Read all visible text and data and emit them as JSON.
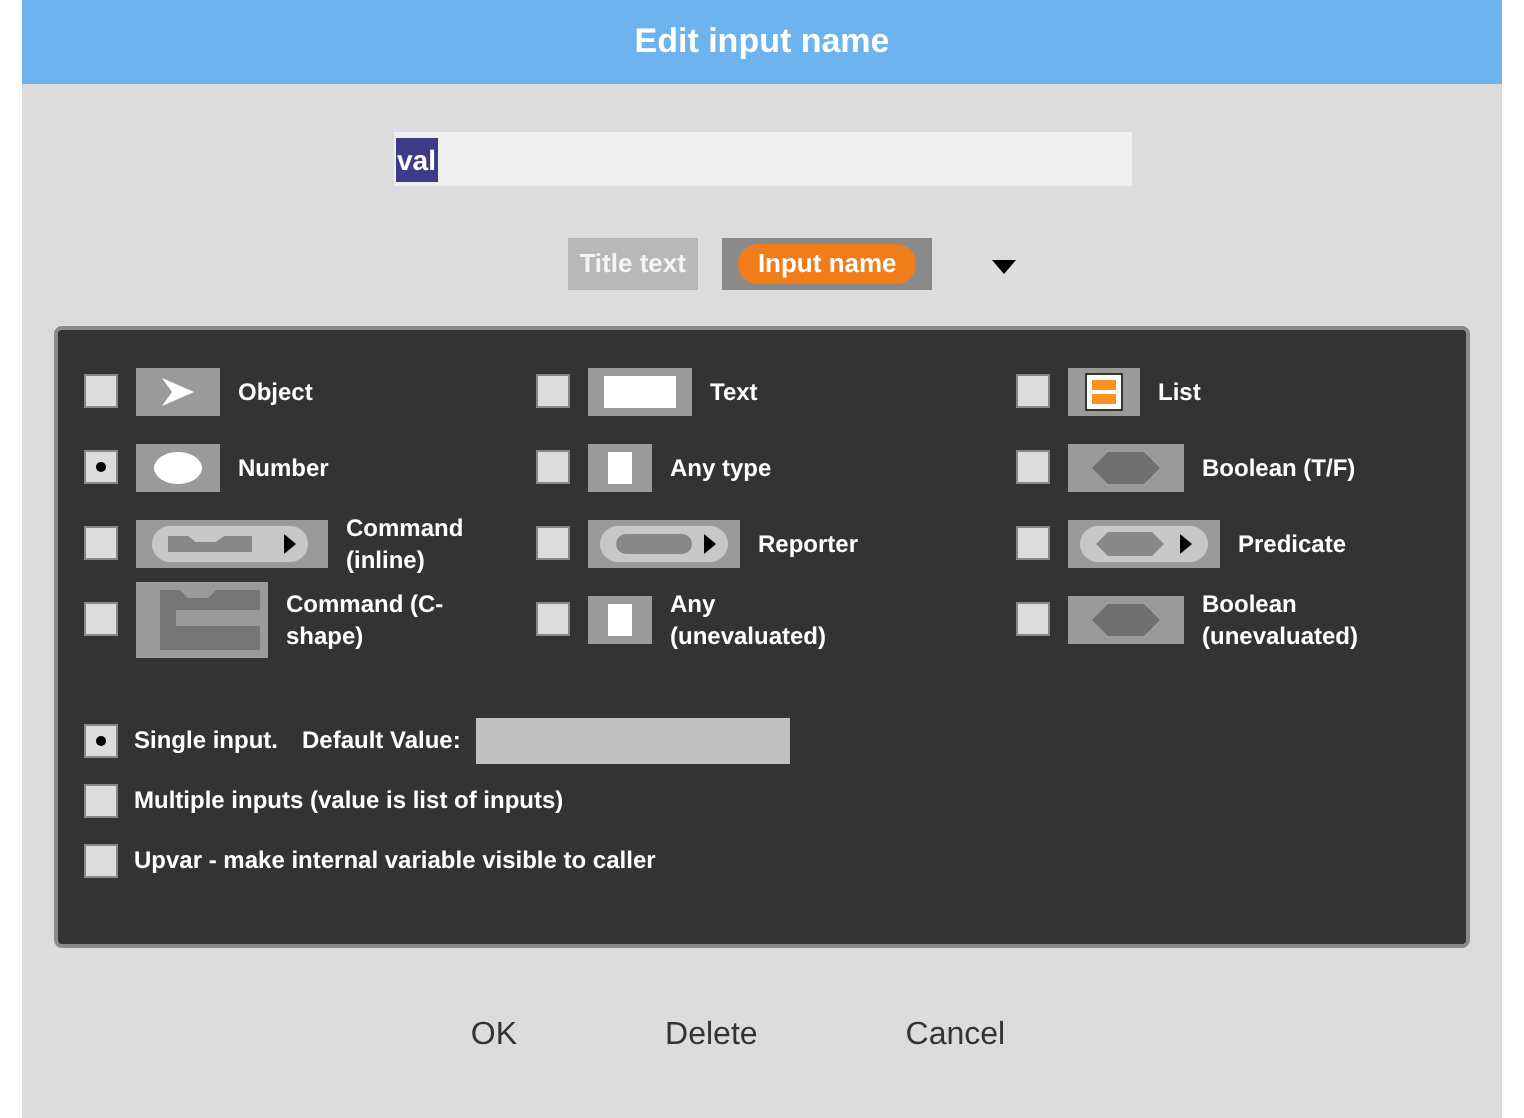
{
  "dialog": {
    "title": "Edit input name"
  },
  "name_field": {
    "value": "val"
  },
  "label_kinds": [
    {
      "label": "Title text",
      "selected": false
    },
    {
      "label": "Input name",
      "selected": true
    }
  ],
  "types": [
    {
      "label": "Object",
      "kind": "object",
      "selected": false
    },
    {
      "label": "Text",
      "kind": "text",
      "selected": false
    },
    {
      "label": "List",
      "kind": "list",
      "selected": false
    },
    {
      "label": "Number",
      "kind": "number",
      "selected": true
    },
    {
      "label": "Any type",
      "kind": "any",
      "selected": false
    },
    {
      "label": "Boolean (T/F)",
      "kind": "boolean",
      "selected": false
    },
    {
      "label": "Command (inline)",
      "kind": "command-inline",
      "selected": false
    },
    {
      "label": "Reporter",
      "kind": "reporter",
      "selected": false
    },
    {
      "label": "Predicate",
      "kind": "predicate",
      "selected": false
    },
    {
      "label": "Command (C-shape)",
      "kind": "command-c",
      "selected": false
    },
    {
      "label": "Any (unevaluated)",
      "kind": "any",
      "selected": false
    },
    {
      "label": "Boolean (unevaluated)",
      "kind": "boolean",
      "selected": false
    }
  ],
  "input_modes": [
    {
      "label": "Single input.",
      "selected": true,
      "default_label": "Default Value:"
    },
    {
      "label": "Multiple inputs (value is list of inputs)",
      "selected": false
    },
    {
      "label": "Upvar - make internal variable visible to caller",
      "selected": false
    }
  ],
  "buttons": [
    "OK",
    "Delete",
    "Cancel"
  ]
}
